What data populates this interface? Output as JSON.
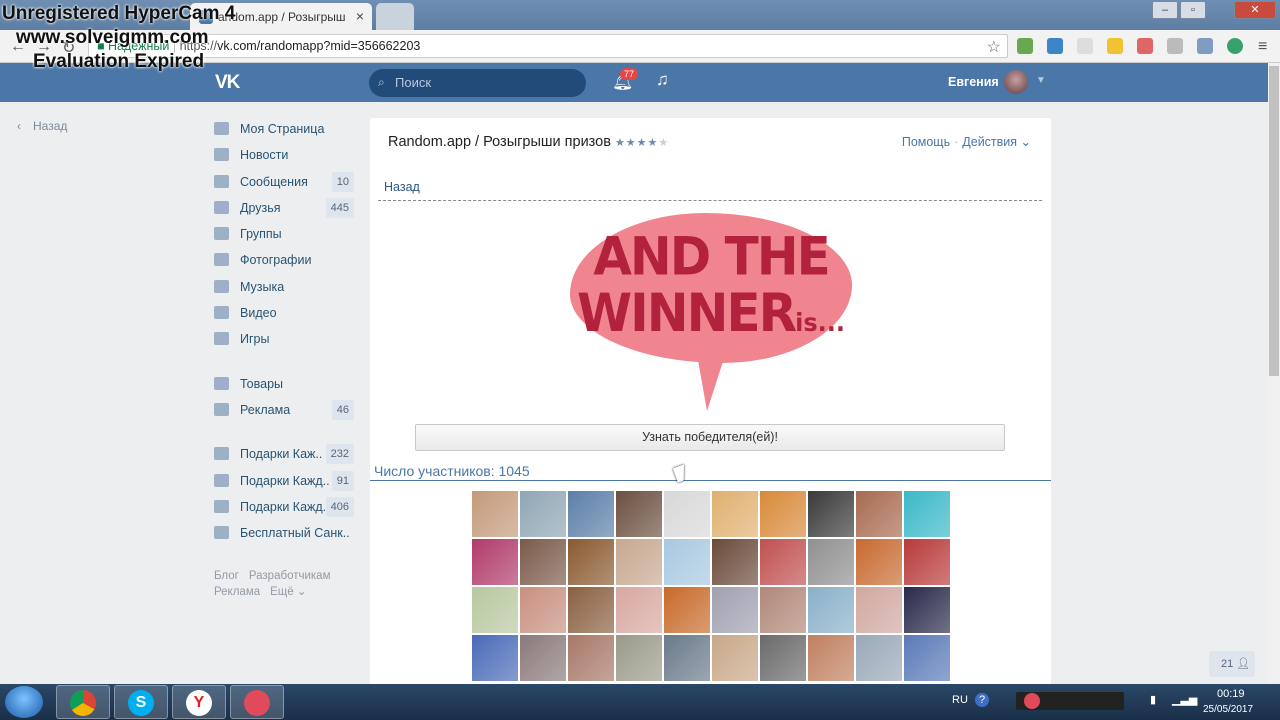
{
  "watermark": {
    "line1": "Unregistered HyperCam 4",
    "line2": "www.solveigmm.com",
    "line3": "Evaluation Expired"
  },
  "browser": {
    "tabs": [
      {
        "label": "andom.app / Розыгрыш",
        "active": true,
        "close": "×"
      },
      {
        "label": "",
        "active": false
      }
    ],
    "address": {
      "secure_label": "Надежный",
      "scheme": "https://",
      "url_rest": "vk.com/randomapp?mid=356662203"
    },
    "window_controls": [
      "–",
      "▫",
      "✕"
    ]
  },
  "vk": {
    "logo": "VK",
    "search_placeholder": "Поиск",
    "notifications_count": "77",
    "user_name": "Евгения",
    "back_label": "Назад",
    "sidebar": [
      {
        "label": "Моя Страница",
        "icon": "home-icon",
        "count": ""
      },
      {
        "label": "Новости",
        "icon": "news-icon",
        "count": ""
      },
      {
        "label": "Сообщения",
        "icon": "messages-icon",
        "count": "10"
      },
      {
        "label": "Друзья",
        "icon": "friends-icon",
        "count": "445"
      },
      {
        "label": "Группы",
        "icon": "groups-icon",
        "count": ""
      },
      {
        "label": "Фотографии",
        "icon": "camera-icon",
        "count": ""
      },
      {
        "label": "Музыка",
        "icon": "music-icon",
        "count": ""
      },
      {
        "label": "Видео",
        "icon": "video-icon",
        "count": ""
      },
      {
        "label": "Игры",
        "icon": "games-icon",
        "count": ""
      },
      {
        "label": "Товары",
        "icon": "goods-icon",
        "count": ""
      },
      {
        "label": "Реклама",
        "icon": "ads-icon",
        "count": "46"
      },
      {
        "label": "Подарки Каж..",
        "icon": "group-icon",
        "count": "232"
      },
      {
        "label": "Подарки Кажд..",
        "icon": "group-icon",
        "count": "91"
      },
      {
        "label": "Подарки Кажд..",
        "icon": "group-icon",
        "count": "406"
      },
      {
        "label": "Бесплатный Санк..",
        "icon": "group-icon",
        "count": ""
      }
    ],
    "footer_links": [
      "Блог",
      "Разработчикам",
      "Реклама",
      "Ещё ⌄"
    ],
    "app": {
      "title": "Random.app / Розыгрыши призов",
      "stars": "★★★★",
      "stars_off": "★",
      "help_link": "Помощь",
      "actions_link": "Действия ⌄",
      "back_link": "Назад",
      "banner_line1": "AND THE",
      "banner_line2": "WINNER",
      "banner_small": "is...",
      "winner_button": "Узнать победителя(ей)!",
      "participants_label": "Число участников: 1045"
    },
    "photo_colors": [
      "#c49a7a",
      "#8fa6b5",
      "#5c7fa8",
      "#6b5040",
      "#d8d8d8",
      "#e0b070",
      "#d88a3a",
      "#3a3a3a",
      "#a86a50",
      "#3ab8c8",
      "#b03a6a",
      "#7a5a4a",
      "#8a5a30",
      "#c8a890",
      "#a8c8e0",
      "#6a4a3a",
      "#c05050",
      "#909090",
      "#c86a30",
      "#b83a3a",
      "#b8c8a0",
      "#c89080",
      "#8a6040",
      "#d8a8a0",
      "#c86a2a",
      "#a0a0b0",
      "#b08878",
      "#8ab0c8",
      "#d0a8a0",
      "#2a2a4a",
      "#4a6ab8",
      "#8a7a7a",
      "#a87868",
      "#9a9a8a",
      "#6a7a8a",
      "#c8a888",
      "#6a6a6a",
      "#c08060",
      "#9aa8b8",
      "#5a7ab8"
    ],
    "chat_count": "21"
  },
  "taskbar": {
    "lang": "RU",
    "time": "00:19",
    "date": "25/05/2017"
  }
}
